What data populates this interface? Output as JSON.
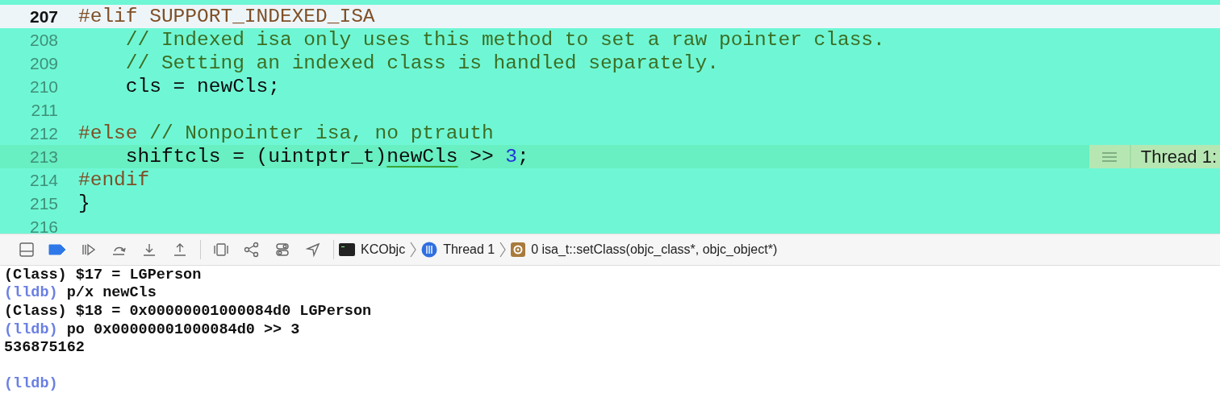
{
  "editor": {
    "lines": [
      {
        "number": "207",
        "current": true,
        "stopped": false,
        "tokens": [
          {
            "kind": "directive",
            "text": "#elif SUPPORT_INDEXED_ISA"
          }
        ]
      },
      {
        "number": "208",
        "current": false,
        "stopped": false,
        "tokens": [
          {
            "kind": "comment",
            "text": "    // Indexed isa only uses this method to set a raw pointer class."
          }
        ]
      },
      {
        "number": "209",
        "current": false,
        "stopped": false,
        "tokens": [
          {
            "kind": "comment",
            "text": "    // Setting an indexed class is handled separately."
          }
        ]
      },
      {
        "number": "210",
        "current": false,
        "stopped": false,
        "tokens": [
          {
            "kind": "plain",
            "text": "    cls = newCls;"
          }
        ]
      },
      {
        "number": "211",
        "current": false,
        "stopped": false
      },
      {
        "number": "212",
        "current": false,
        "stopped": false,
        "tokens": [
          {
            "kind": "directive",
            "text": "#else "
          },
          {
            "kind": "comment",
            "text": "// Nonpointer isa, no ptrauth"
          }
        ]
      },
      {
        "number": "213",
        "current": false,
        "stopped": true,
        "tokens": [
          {
            "kind": "plain",
            "text": "    shiftcls = (uintptr_t)"
          },
          {
            "kind": "plain",
            "text": "newCls",
            "underline": true
          },
          {
            "kind": "plain",
            "text": " >> "
          },
          {
            "kind": "number",
            "text": "3"
          },
          {
            "kind": "plain",
            "text": ";"
          }
        ],
        "annotation": "Thread 1:"
      },
      {
        "number": "214",
        "current": false,
        "stopped": false,
        "tokens": [
          {
            "kind": "directive",
            "text": "#endif"
          }
        ]
      },
      {
        "number": "215",
        "current": false,
        "stopped": false,
        "tokens": [
          {
            "kind": "plain",
            "text": "}"
          }
        ]
      },
      {
        "number": "216",
        "current": false,
        "stopped": false
      }
    ]
  },
  "debug_bar": {
    "breakpoints_active": true,
    "breadcrumbs": [
      {
        "kind": "app",
        "label": "KCObjc"
      },
      {
        "kind": "thread",
        "label": "Thread 1"
      },
      {
        "kind": "frame",
        "label": "0 isa_t::setClass(objc_class*, objc_object*)"
      }
    ]
  },
  "console": {
    "lines": [
      {
        "kind": "output",
        "text": "(Class) $17 = LGPerson"
      },
      {
        "kind": "input",
        "prompt": "(lldb)",
        "text": "p/x newCls"
      },
      {
        "kind": "output",
        "text": "(Class) $18 = 0x00000001000084d0 LGPerson"
      },
      {
        "kind": "input",
        "prompt": "(lldb)",
        "text": "po 0x00000001000084d0 >> 3"
      },
      {
        "kind": "output",
        "text": "536875162"
      },
      {
        "kind": "blank"
      },
      {
        "kind": "input",
        "prompt": "(lldb)"
      }
    ]
  }
}
